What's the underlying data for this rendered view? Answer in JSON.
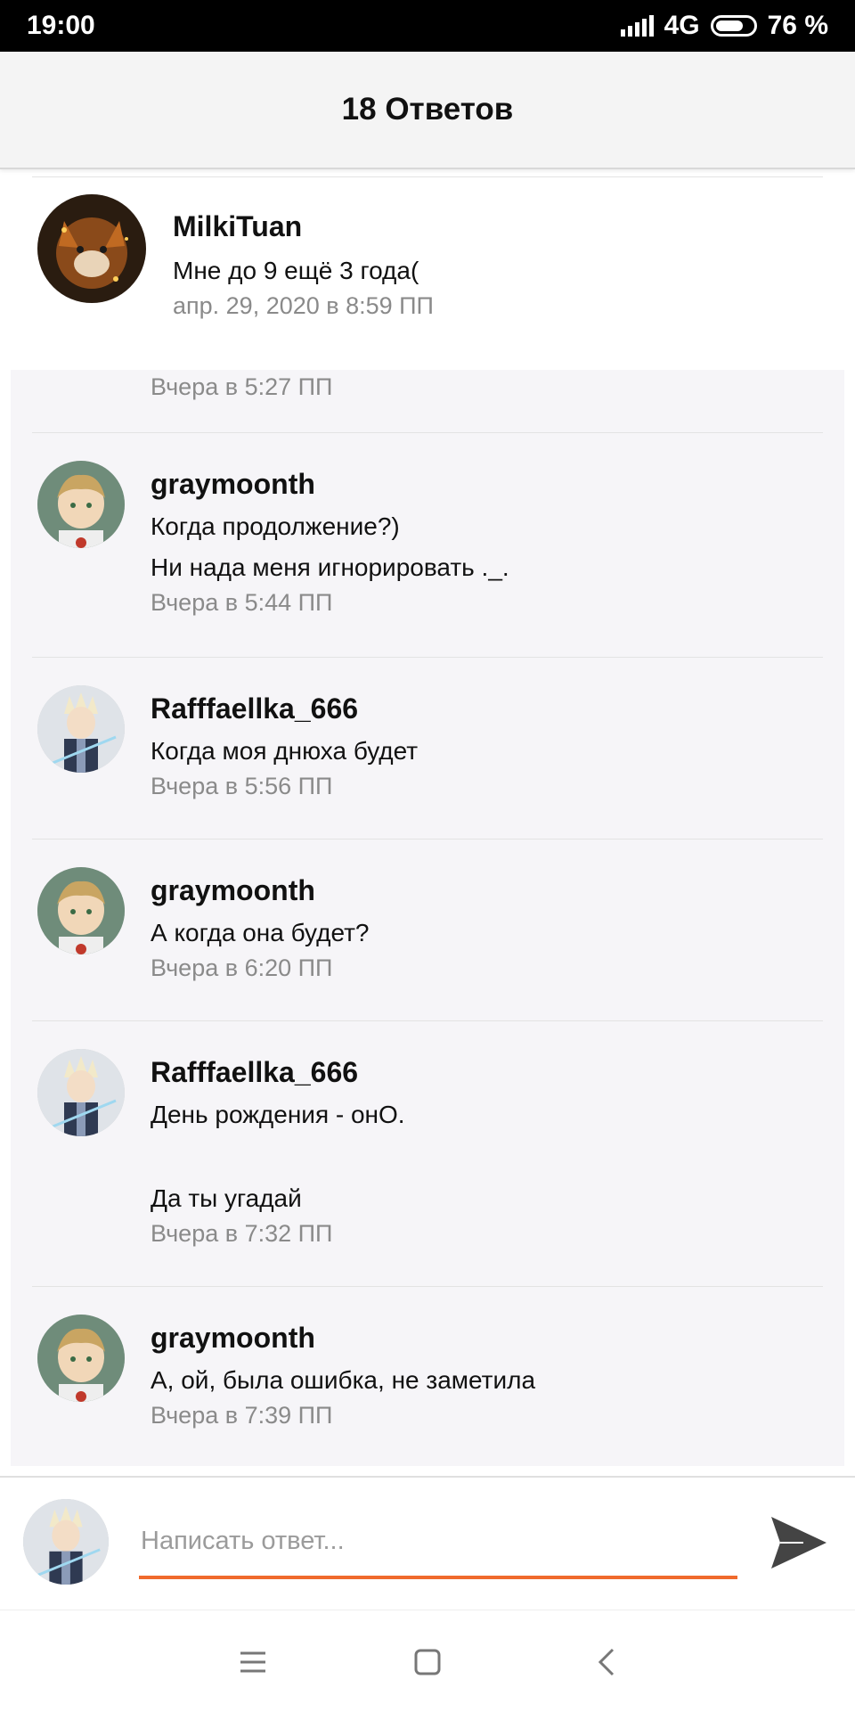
{
  "status_bar": {
    "time": "19:00",
    "network": "4G",
    "battery": "76 %",
    "battery_level": 0.76
  },
  "header": {
    "title": "18 Ответов"
  },
  "parent_comment": {
    "username": "MilkiTuan",
    "text": "Мне до 9 ещё 3 года(",
    "time": "апр. 29, 2020 в 8:59 ПП"
  },
  "replies": [
    {
      "time": "Вчера в 5:27 ПП"
    },
    {
      "username": "graymoonth",
      "lines": [
        "Когда продолжение?)",
        "Ни нада меня игнорировать ._."
      ],
      "time": "Вчера в 5:44 ПП"
    },
    {
      "username": "Rafffaellka_666",
      "lines": [
        "Когда моя днюха будет"
      ],
      "time": "Вчера в 5:56 ПП"
    },
    {
      "username": "graymoonth",
      "lines": [
        "А когда она будет?"
      ],
      "time": "Вчера в 6:20 ПП"
    },
    {
      "username": "Rafffaellka_666",
      "lines": [
        "День рождения - онО.",
        "Да ты угадай"
      ],
      "time": "Вчера в 7:32 ПП"
    },
    {
      "username": "graymoonth",
      "lines": [
        "А, ой, была ошибка, не заметила"
      ],
      "time": "Вчера в 7:39 ПП"
    }
  ],
  "composer": {
    "placeholder": "Написать ответ...",
    "accent_color": "#f06a2c"
  },
  "nav": {
    "icons": [
      "menu-icon",
      "home-square-icon",
      "back-icon"
    ]
  }
}
